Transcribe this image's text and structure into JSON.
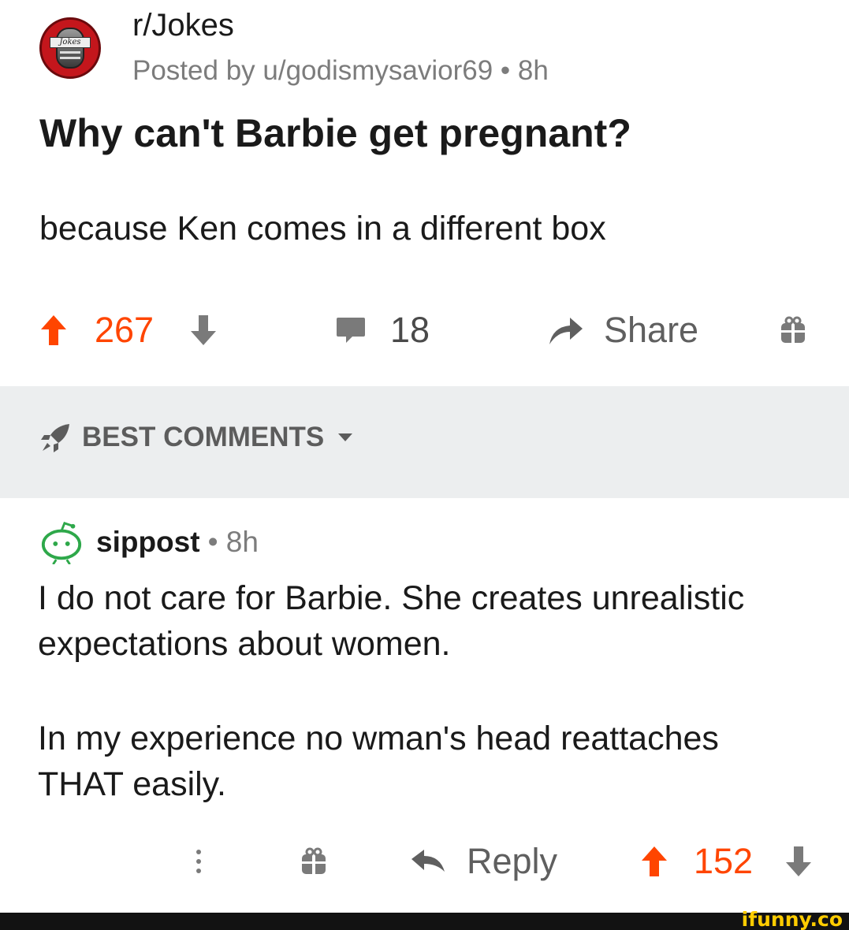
{
  "post": {
    "subreddit": "r/Jokes",
    "posted_by": "Posted by u/godismysavior69 • 8h",
    "avatar_text": "Jokes",
    "title": "Why can't Barbie get pregnant?",
    "body": "because Ken comes in a different box",
    "upvotes": "267",
    "comments": "18",
    "share_label": "Share"
  },
  "sort": {
    "label": "BEST COMMENTS"
  },
  "comment": {
    "user": "sippost",
    "time": "• 8h",
    "lines": [
      "I do not care for Barbie. She creates unrealistic",
      "expectations about women.",
      "In my experience no wman's head reattaches",
      "THAT easily."
    ],
    "reply_label": "Reply",
    "upvotes": "152"
  },
  "watermark": "ifunny.co",
  "colors": {
    "upvote": "#ff4500",
    "icon_gray": "#7a7a7a",
    "sort_bar_bg": "#eceeef"
  },
  "icons": [
    "upvote-arrow",
    "downvote-arrow",
    "comment-bubble",
    "share-arrow",
    "gift-box",
    "rocket",
    "caret-down",
    "snoo-avatar",
    "more-dots",
    "reply-arrow"
  ]
}
